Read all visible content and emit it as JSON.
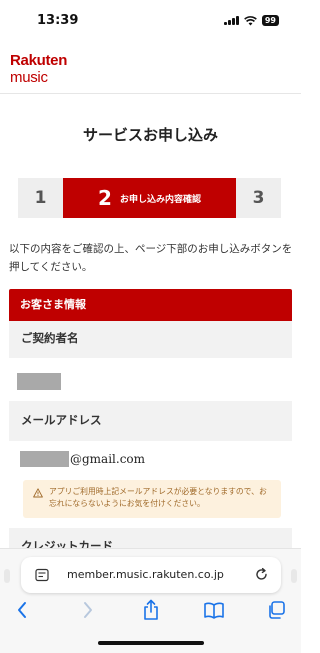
{
  "status_bar": {
    "time": "13:39",
    "battery": "99"
  },
  "brand": {
    "line1": "Rakuten",
    "line2": "music",
    "color": "#bf0000"
  },
  "page": {
    "title": "サービスお申し込み",
    "steps": [
      {
        "number": "1",
        "label": ""
      },
      {
        "number": "2",
        "label": "お申し込み内容確認",
        "active": true
      },
      {
        "number": "3",
        "label": ""
      }
    ],
    "intro": "以下の内容をご確認の上、ページ下部のお申し込みボタンを押してください。"
  },
  "customer_info": {
    "header": "お客さま情報",
    "contract_name_label": "ご契約者名",
    "email_label": "メールアドレス",
    "email_domain": "@gmail.com",
    "notice": "アプリご利用時上記メールアドレスが必要となりますので、お忘れにならないようにお気を付けください。",
    "card_label": "クレジットカード"
  },
  "browser": {
    "url": "member.music.rakuten.co.jp",
    "icons": [
      "page-menu-icon",
      "reload-icon",
      "back-icon",
      "forward-icon",
      "share-icon",
      "bookmarks-icon",
      "tabs-icon"
    ]
  }
}
